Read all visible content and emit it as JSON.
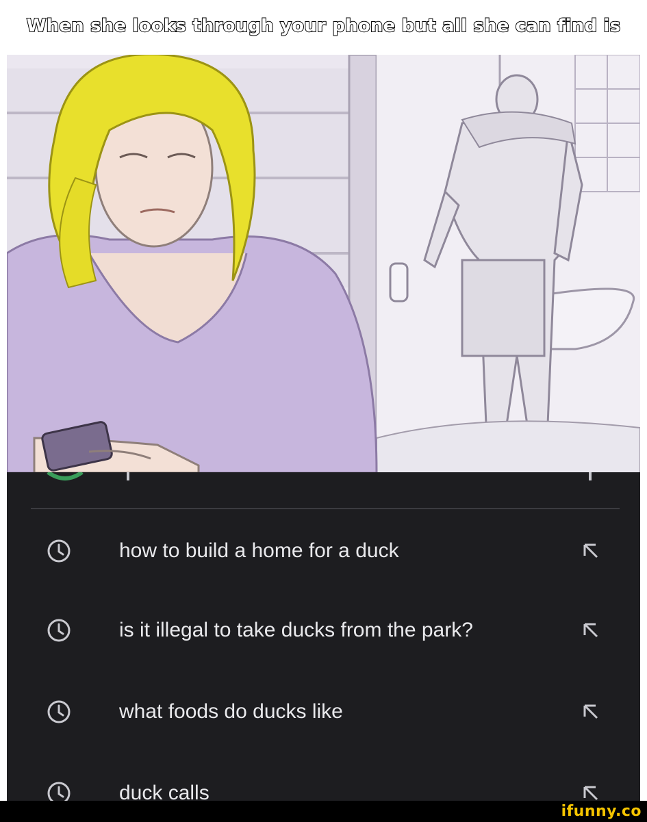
{
  "caption": "When she looks through your phone but all she can find is",
  "search_history": {
    "items": [
      {
        "label": "how to build a home for a duck",
        "icon": "history-clock-icon",
        "action_icon": "insert-query-arrow-icon"
      },
      {
        "label": "is it illegal to take ducks from the park?",
        "icon": "history-clock-icon",
        "action_icon": "insert-query-arrow-icon"
      },
      {
        "label": "what foods do ducks like",
        "icon": "history-clock-icon",
        "action_icon": "insert-query-arrow-icon"
      },
      {
        "label": "duck calls",
        "icon": "history-clock-icon",
        "action_icon": "insert-query-arrow-icon"
      }
    ]
  },
  "watermark": "ifunny.co",
  "colors": {
    "panel_bg": "#1d1d20",
    "text": "#e9e9ec",
    "icon": "#c9c9cf",
    "watermark": "#f5c400",
    "caption_stroke": "#000000"
  }
}
